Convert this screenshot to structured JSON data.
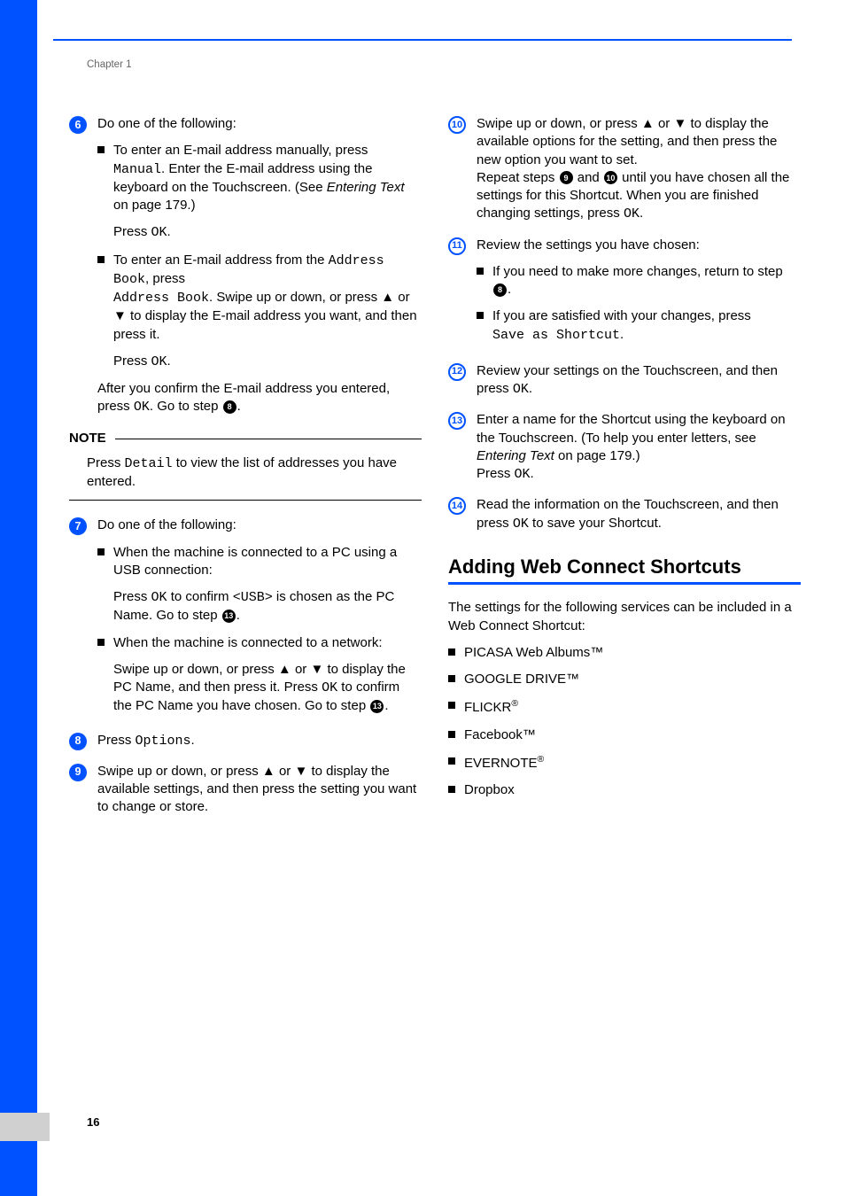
{
  "chapter": "Chapter 1",
  "page_number": "16",
  "left": {
    "step6": {
      "num": "6",
      "intro": "Do one of the following:",
      "b1_a": "To enter an E-mail address manually, press ",
      "b1_code1": "Manual",
      "b1_b": ". Enter the E-mail address using the keyboard on the Touchscreen. (See ",
      "b1_link": "Entering Text",
      "b1_c": " on page 179.)",
      "b1_press": "Press ",
      "ok": "OK",
      "b1_dot": ".",
      "b2_a": "To enter an E-mail address from the ",
      "b2_code1": "Address Book",
      "b2_b": ", press ",
      "b2_code2": "Address Book",
      "b2_c": ". Swipe up or down, or press ▲ or ▼ to display the E-mail address you want, and then press it.",
      "after_a": "After you confirm the E-mail address you entered, press ",
      "after_b": ". Go to step ",
      "after_ref": "8",
      "after_dot": "."
    },
    "note": {
      "label": "NOTE",
      "text_a": "Press ",
      "text_code": "Detail",
      "text_b": " to view the list of addresses you have entered."
    },
    "step7": {
      "num": "7",
      "intro": "Do one of the following:",
      "b1": "When the machine is connected to a PC using a USB connection:",
      "b1p_a": "Press ",
      "b1p_b": " to confirm ",
      "b1p_code": "<USB>",
      "b1p_c": " is chosen as the PC Name. Go to step ",
      "b1p_ref": "13",
      "b1p_dot": ".",
      "b2": "When the machine is connected to a network:",
      "b2p_a": "Swipe up or down, or press ▲ or ▼ to display the PC Name, and then press it. Press ",
      "b2p_b": " to confirm the PC Name you have chosen. Go to step ",
      "b2p_ref": "13",
      "b2p_dot": "."
    },
    "step8": {
      "num": "8",
      "text_a": "Press ",
      "text_code": "Options",
      "text_b": "."
    },
    "step9": {
      "num": "9",
      "text": "Swipe up or down, or press ▲ or ▼ to display the available settings, and then press the setting you want to change or store."
    }
  },
  "right": {
    "step10": {
      "num": "10",
      "p1": "Swipe up or down, or press ▲ or ▼ to display the available options for the setting, and then press the new option you want to set.",
      "p2_a": "Repeat steps ",
      "p2_ref1": "9",
      "p2_b": " and ",
      "p2_ref2": "10",
      "p2_c": " until you have chosen all the settings for this Shortcut. When you are finished changing settings, press ",
      "ok": "OK",
      "p2_d": "."
    },
    "step11": {
      "num": "11",
      "intro": "Review the settings you have chosen:",
      "b1_a": "If you need to make more changes, return to step ",
      "b1_ref": "8",
      "b1_b": ".",
      "b2_a": "If you are satisfied with your changes, press ",
      "b2_code": "Save as Shortcut",
      "b2_b": "."
    },
    "step12": {
      "num": "12",
      "text_a": "Review your settings on the Touchscreen, and then press ",
      "ok": "OK",
      "text_b": "."
    },
    "step13": {
      "num": "13",
      "text_a": "Enter a name for the Shortcut using the keyboard on the Touchscreen. (To help you enter letters, see ",
      "text_link": "Entering Text",
      "text_b": " on page 179.)",
      "press": "Press ",
      "ok": "OK",
      "dot": "."
    },
    "step14": {
      "num": "14",
      "text_a": "Read the information on the Touchscreen, and then press ",
      "ok": "OK",
      "text_b": " to save your Shortcut."
    },
    "section": {
      "heading": "Adding Web Connect Shortcuts",
      "intro": "The settings for the following services can be included in a Web Connect Shortcut:",
      "services": [
        "PICASA Web Albums™",
        "GOOGLE DRIVE™",
        "FLICKR",
        "Facebook™",
        "EVERNOTE",
        "Dropbox"
      ],
      "flickr_sup": "®",
      "evernote_sup": "®"
    }
  }
}
